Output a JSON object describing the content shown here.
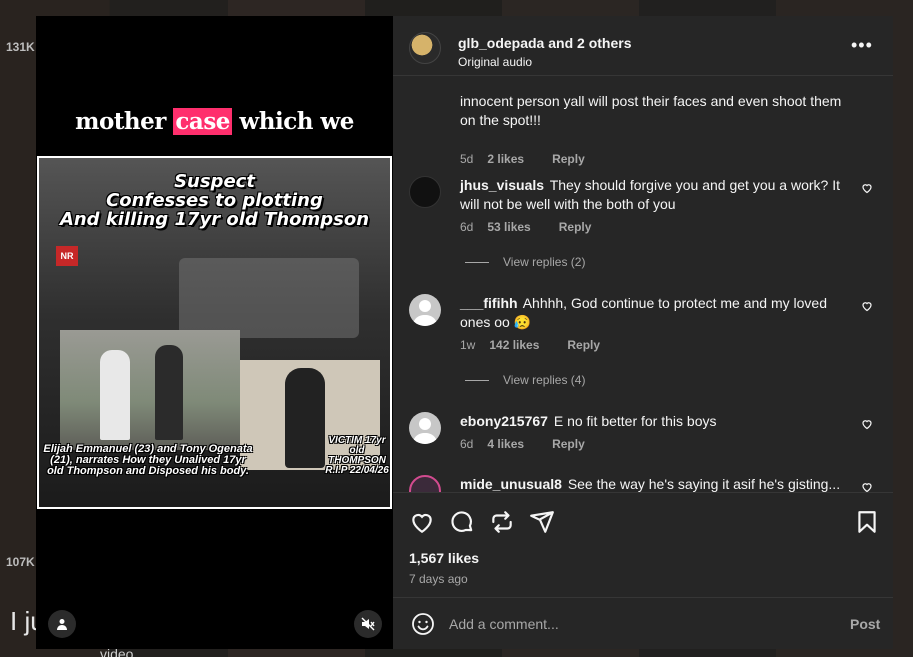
{
  "background": {
    "count_top": "131K",
    "count_bottom": "107K",
    "partial_text": "I ju",
    "partial_text2": "video"
  },
  "video": {
    "caption_before": "mother ",
    "caption_highlight": "case",
    "caption_after": " which we",
    "headline_line1": "Suspect",
    "headline_line2": "Confesses to plotting",
    "headline_line3": "And killing 17yr old Thompson",
    "logo_text": "NR",
    "caption_left": "Elijah Emmanuel (23) and Tony Ogenata (21), narrates How they Unalived 17yr old Thompson and Disposed his body.",
    "caption_right": "VICTIM 17yr old THOMPSON R.I.P 22/04/26"
  },
  "header": {
    "username": "glb_odepada",
    "others": "and 2 others",
    "subtitle": "Original audio"
  },
  "comments": [
    {
      "partial": true,
      "text": "innocent person yall will post their faces and even shoot them on the spot!!!",
      "time": "5d",
      "likes": "2 likes",
      "reply": "Reply"
    },
    {
      "user": "jhus_visuals",
      "text": "They should forgive you and get you a work? It will not be well with the both of you",
      "time": "6d",
      "likes": "53 likes",
      "reply": "Reply",
      "view_replies": "View replies (2)"
    },
    {
      "user": "___fifihh",
      "text": "Ahhhh, God continue to protect me and my loved ones oo 😥",
      "time": "1w",
      "likes": "142 likes",
      "reply": "Reply",
      "view_replies": "View replies (4)"
    },
    {
      "user": "ebony215767",
      "text": "E no fit better for this boys",
      "time": "6d",
      "likes": "4 likes",
      "reply": "Reply"
    },
    {
      "user": "mide_unusual8",
      "text": "See the way he's saying it asif he's gisting..."
    }
  ],
  "stats": {
    "likes": "1,567 likes",
    "ago": "7 days ago"
  },
  "composer": {
    "placeholder": "Add a comment...",
    "post": "Post"
  },
  "colors": {
    "panel": "#262626",
    "highlight": "#ff2f6d",
    "muted": "#a8a8a8"
  }
}
